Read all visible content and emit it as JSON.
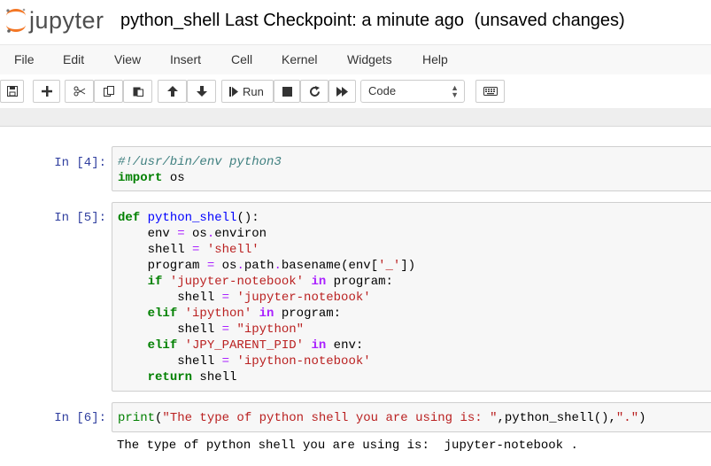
{
  "header": {
    "logo_text": "jupyter",
    "notebook_name": "python_shell",
    "checkpoint": "Last Checkpoint: a minute ago",
    "status": "(unsaved changes)"
  },
  "menu": [
    "File",
    "Edit",
    "View",
    "Insert",
    "Cell",
    "Kernel",
    "Widgets",
    "Help"
  ],
  "toolbar": {
    "run_label": "Run",
    "cell_type": "Code",
    "icons": [
      "save-icon",
      "plus-icon",
      "cut-icon",
      "copy-icon",
      "paste-icon",
      "arrow-up-icon",
      "arrow-down-icon",
      "step-forward-icon",
      "stop-icon",
      "restart-icon",
      "fast-forward-icon",
      "keyboard-icon"
    ]
  },
  "cells": [
    {
      "prompt": "In [4]:",
      "lines": [
        "#!/usr/bin/env python3",
        "import os"
      ]
    },
    {
      "prompt": "In [5]:",
      "lines": [
        "def python_shell():",
        "    env = os.environ",
        "    shell = 'shell'",
        "    program = os.path.basename(env['_'])",
        "    if 'jupyter-notebook' in program:",
        "        shell = 'jupyter-notebook'",
        "    elif 'ipython' in program:",
        "        shell = \"ipython\"",
        "    elif 'JPY_PARENT_PID' in env:",
        "        shell = 'ipython-notebook'",
        "    return shell"
      ]
    },
    {
      "prompt": "In [6]:",
      "lines": [
        "print(\"The type of python shell you are using is: \",python_shell(),\".\")"
      ],
      "output": "The type of python shell you are using is:  jupyter-notebook ."
    }
  ],
  "colors": {
    "prompt": "#303f9f",
    "keyword": "#008000",
    "string": "#ba2121",
    "operator": "#aa22ff",
    "function": "#0000ff",
    "comment": "#408080",
    "logo_orange": "#f37726"
  }
}
